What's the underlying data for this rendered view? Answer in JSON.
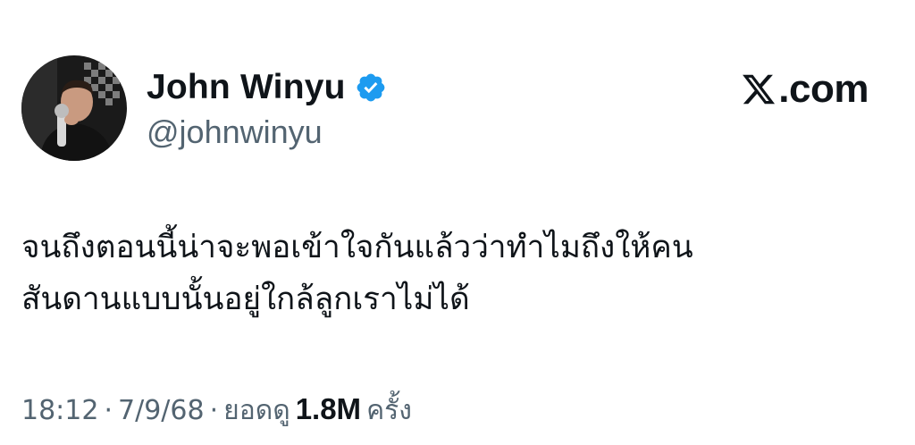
{
  "author": {
    "display_name": "John Winyu",
    "handle": "@johnwinyu",
    "verified": true,
    "badge_color": "#1d9bf0"
  },
  "brand": {
    "domain": ".com",
    "logo_icon": "x-logo-icon"
  },
  "tweet": {
    "text": "จนถึงตอนนี้น่าจะพอเข้าใจกันแล้วว่าทำไมถึงให้คน\nสันดานแบบนั้นอยู่ใกล้ลูกเราไม่ได้"
  },
  "meta": {
    "time": "18:12",
    "separator": "·",
    "date": "7/9/68",
    "views_label": "ยอดดู",
    "views_count": "1.8M",
    "views_suffix": "ครั้ง"
  },
  "colors": {
    "text_primary": "#0f1419",
    "text_secondary": "#536471",
    "background": "#ffffff"
  }
}
